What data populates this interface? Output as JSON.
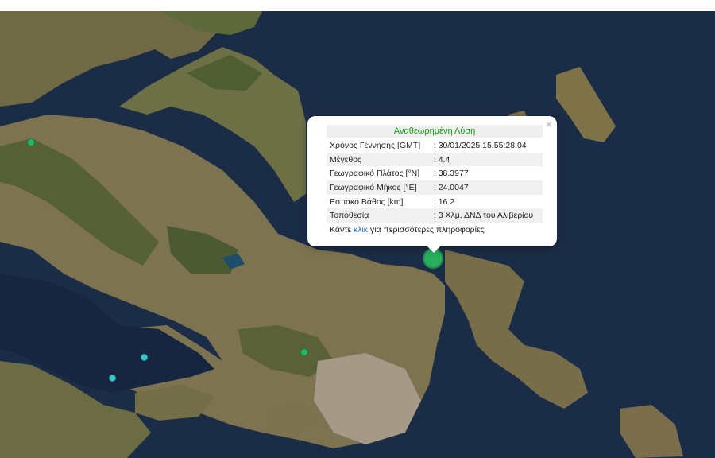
{
  "map": {
    "markers": [
      {
        "name": "quake-marker-selected",
        "color": "#27ad5c",
        "size": "large"
      },
      {
        "name": "quake-marker-west",
        "color": "#2ab363",
        "size": "small"
      },
      {
        "name": "quake-marker-central",
        "color": "#2ab363",
        "size": "small"
      },
      {
        "name": "quake-marker-gulf-1",
        "color": "#38c6cc",
        "size": "small"
      },
      {
        "name": "quake-marker-gulf-2",
        "color": "#38c6cc",
        "size": "small"
      }
    ]
  },
  "popup": {
    "close_label": "×",
    "title": "Αναθεωρημένη Λύση",
    "rows": [
      {
        "label": "Χρόνος Γέννησης [GMT]",
        "value": ": 30/01/2025 15:55:28.04"
      },
      {
        "label": "Μέγεθος",
        "value": ": 4.4"
      },
      {
        "label": "Γεωγραφικό Πλάτος [°N]",
        "value": ": 38.3977"
      },
      {
        "label": "Γεωγραφικό Μήκος [°E]",
        "value": ": 24.0047"
      },
      {
        "label": "Εστιακό Βάθος [km]",
        "value": ": 16.2"
      },
      {
        "label": "Τοποθεσία",
        "value": ": 3 Χλμ. ΔΝΔ του Αλιβερίου"
      }
    ],
    "more_prefix": "Κάντε ",
    "more_link": "κλικ",
    "more_suffix": " για περισσότερες πληροφορίες"
  },
  "colors": {
    "sea": "#1a2c44",
    "land": "#7d7350",
    "forest": "#4f5a34",
    "urban": "#a59a88",
    "title_green": "#11a011",
    "link": "#2a6fc9"
  }
}
